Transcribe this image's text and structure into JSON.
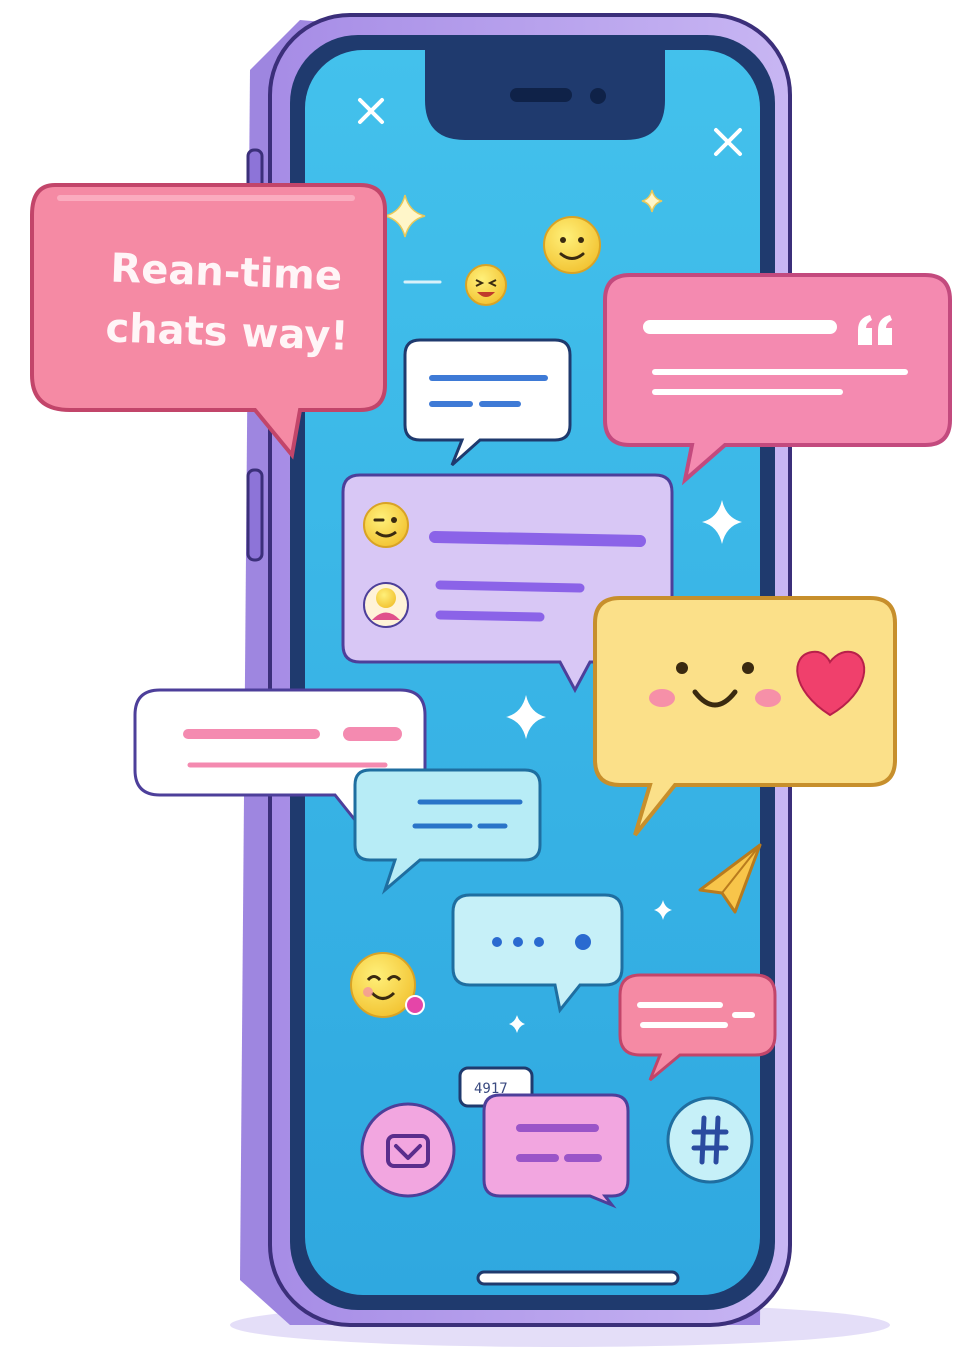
{
  "tagline_bubble": {
    "line1": "Rean-time",
    "line2": "chats way!"
  },
  "message_counter": {
    "value": "4917"
  },
  "icons": {
    "close_left": "close-icon",
    "close_right": "close-icon",
    "typing": "ellipsis-icon",
    "heart": "heart-icon",
    "quote": "quote-icon",
    "send": "paper-plane-icon",
    "left_action": "chat-heart-icon",
    "right_action": "hashtag-icon"
  },
  "colors": {
    "screen": "#38b6e6",
    "phone_frame": "#b9a4ec",
    "bezel": "#1f3a6e",
    "pink_bubble": "#f48aa6",
    "yellow_bubble": "#fbe089",
    "lilac_bubble": "#d9c8f5",
    "emoji_yellow": "#f9d64f"
  }
}
